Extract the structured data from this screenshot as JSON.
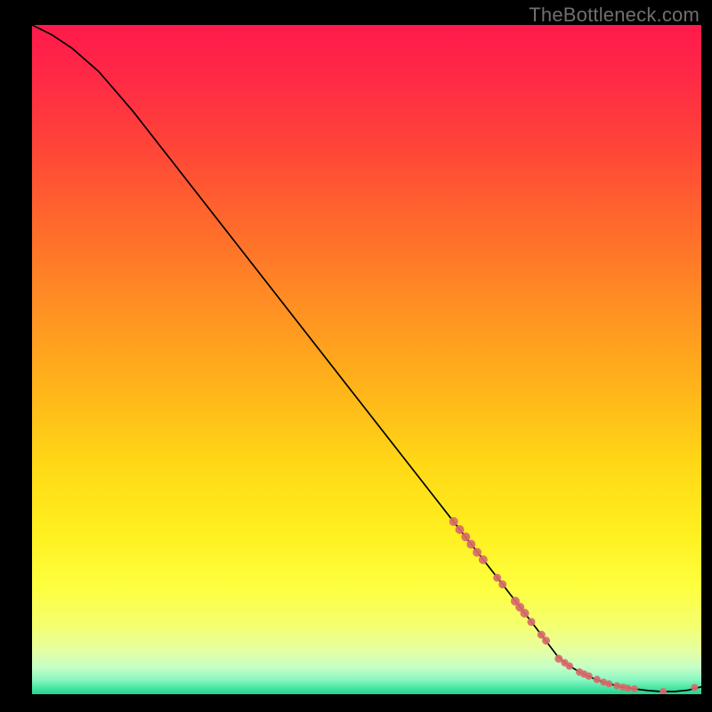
{
  "watermark": "TheBottleneck.com",
  "chart_data": {
    "type": "line",
    "title": "",
    "xlabel": "",
    "ylabel": "",
    "xlim": [
      0,
      100
    ],
    "ylim": [
      0,
      100
    ],
    "series": [
      {
        "name": "bottleneck-curve",
        "x": [
          0,
          3,
          6,
          10,
          15,
          20,
          25,
          30,
          35,
          40,
          45,
          50,
          55,
          60,
          65,
          70,
          75,
          78.5,
          80,
          82,
          84,
          86,
          88,
          90,
          92,
          94,
          96,
          98,
          100
        ],
        "y": [
          100,
          98.5,
          96.5,
          93,
          87.2,
          80.8,
          74.4,
          68,
          61.6,
          55.2,
          48.8,
          42.4,
          36,
          29.6,
          23.2,
          16.8,
          10.3,
          5.7,
          4.4,
          3.2,
          2.3,
          1.6,
          1.1,
          0.8,
          0.55,
          0.4,
          0.4,
          0.6,
          1.1
        ]
      }
    ],
    "markers": {
      "name": "highlighted-points",
      "color": "#d86a6a",
      "points": [
        {
          "x": 63.0,
          "y": 25.8,
          "r": 5.0
        },
        {
          "x": 63.9,
          "y": 24.6,
          "r": 5.0
        },
        {
          "x": 64.8,
          "y": 23.5,
          "r": 5.0
        },
        {
          "x": 65.6,
          "y": 22.4,
          "r": 5.0
        },
        {
          "x": 66.5,
          "y": 21.2,
          "r": 5.0
        },
        {
          "x": 67.4,
          "y": 20.1,
          "r": 5.0
        },
        {
          "x": 69.5,
          "y": 17.4,
          "r": 4.5
        },
        {
          "x": 70.3,
          "y": 16.4,
          "r": 4.5
        },
        {
          "x": 72.2,
          "y": 13.9,
          "r": 5.0
        },
        {
          "x": 72.9,
          "y": 13.0,
          "r": 5.0
        },
        {
          "x": 73.6,
          "y": 12.1,
          "r": 5.0
        },
        {
          "x": 74.6,
          "y": 10.8,
          "r": 4.5
        },
        {
          "x": 76.1,
          "y": 8.9,
          "r": 4.5
        },
        {
          "x": 76.8,
          "y": 8.0,
          "r": 4.5
        },
        {
          "x": 78.7,
          "y": 5.3,
          "r": 4.5
        },
        {
          "x": 79.6,
          "y": 4.7,
          "r": 4.2
        },
        {
          "x": 80.3,
          "y": 4.2,
          "r": 4.2
        },
        {
          "x": 81.8,
          "y": 3.3,
          "r": 4.2
        },
        {
          "x": 82.5,
          "y": 3.0,
          "r": 4.2
        },
        {
          "x": 83.2,
          "y": 2.7,
          "r": 4.2
        },
        {
          "x": 84.4,
          "y": 2.2,
          "r": 4.2
        },
        {
          "x": 85.4,
          "y": 1.8,
          "r": 4.0
        },
        {
          "x": 86.2,
          "y": 1.55,
          "r": 4.0
        },
        {
          "x": 87.4,
          "y": 1.25,
          "r": 4.0
        },
        {
          "x": 88.3,
          "y": 1.05,
          "r": 4.0
        },
        {
          "x": 89.0,
          "y": 0.9,
          "r": 4.0
        },
        {
          "x": 90.0,
          "y": 0.8,
          "r": 4.0
        },
        {
          "x": 94.3,
          "y": 0.4,
          "r": 4.0
        },
        {
          "x": 99.0,
          "y": 1.0,
          "r": 4.0
        }
      ]
    },
    "gradient_stops": [
      {
        "offset": 0.0,
        "color": "#ff1a4b"
      },
      {
        "offset": 0.08,
        "color": "#ff2a46"
      },
      {
        "offset": 0.18,
        "color": "#ff4438"
      },
      {
        "offset": 0.3,
        "color": "#ff6a2c"
      },
      {
        "offset": 0.42,
        "color": "#ff8f23"
      },
      {
        "offset": 0.54,
        "color": "#ffb31a"
      },
      {
        "offset": 0.66,
        "color": "#ffd916"
      },
      {
        "offset": 0.76,
        "color": "#fff020"
      },
      {
        "offset": 0.84,
        "color": "#fdff3f"
      },
      {
        "offset": 0.9,
        "color": "#f4ff72"
      },
      {
        "offset": 0.935,
        "color": "#e4ffa3"
      },
      {
        "offset": 0.96,
        "color": "#c5ffc6"
      },
      {
        "offset": 0.978,
        "color": "#8cf7c2"
      },
      {
        "offset": 0.992,
        "color": "#43e3a0"
      },
      {
        "offset": 1.0,
        "color": "#1fd48f"
      }
    ]
  }
}
